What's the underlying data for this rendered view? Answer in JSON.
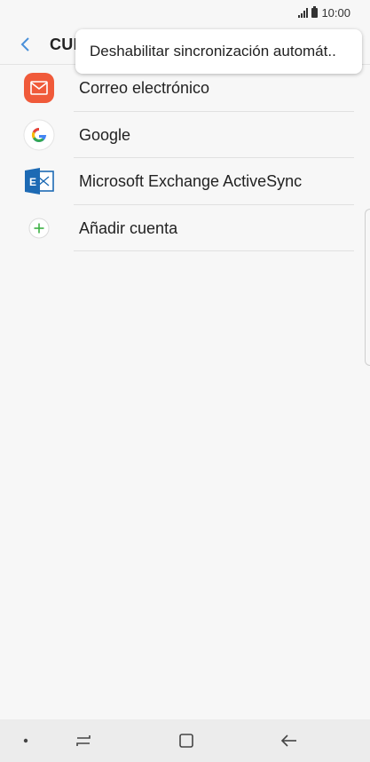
{
  "status_bar": {
    "time": "10:00",
    "icons": [
      "signal-icon",
      "battery-icon"
    ]
  },
  "header": {
    "back_icon": "back-arrow-icon",
    "title": "CUENTAS"
  },
  "popup_menu": {
    "items": [
      {
        "label": "Deshabilitar sincronización automát.."
      }
    ]
  },
  "accounts": [
    {
      "label": "Correo electrónico",
      "icon": "email-icon"
    },
    {
      "label": "Google",
      "icon": "google-icon"
    },
    {
      "label": "Microsoft Exchange ActiveSync",
      "icon": "exchange-icon"
    },
    {
      "label": "Añadir cuenta",
      "icon": "add-icon"
    }
  ],
  "nav_bar": {
    "icons": [
      "dot-icon",
      "recent-apps-icon",
      "home-icon",
      "back-icon"
    ]
  },
  "colors": {
    "accent": "#4a90d9",
    "email_icon": "#f05a3a",
    "exchange_icon": "#1d6ab4",
    "add_icon": "#3cb043",
    "background": "#f7f7f7"
  }
}
